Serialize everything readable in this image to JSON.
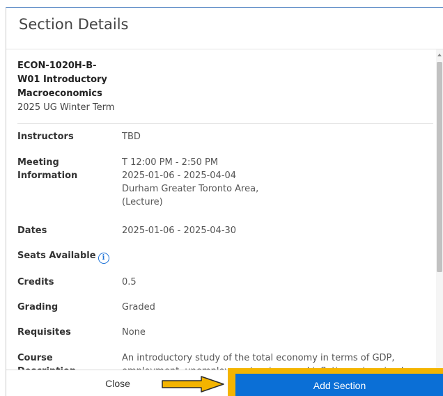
{
  "dialog": {
    "title": "Section Details"
  },
  "course": {
    "code_line1": "ECON-1020H-B-",
    "code_line2": "W01 Introductory",
    "code_line3": "Macroeconomics",
    "term": "2025 UG Winter Term"
  },
  "details": {
    "instructors_label": "Instructors",
    "instructors_value": "TBD",
    "meeting_label_line1": "Meeting",
    "meeting_label_line2": "Information",
    "meeting_time": "T 12:00 PM - 2:50 PM",
    "meeting_dates": "2025-01-06 - 2025-04-04",
    "meeting_location": "Durham Greater Toronto Area,",
    "meeting_type": "(Lecture)",
    "dates_label": "Dates",
    "dates_value": "2025-01-06 - 2025-04-30",
    "seats_label": "Seats Available",
    "seats_icon_glyph": "i",
    "credits_label": "Credits",
    "credits_value": "0.5",
    "grading_label": "Grading",
    "grading_value": "Graded",
    "requisites_label": "Requisites",
    "requisites_value": "None",
    "description_label_line1": "Course",
    "description_label_line2": "Description",
    "description_line1": "An introductory study of the total economy in terms of GDP,",
    "description_line2": "employment, unemployment, prices, and inflation using simple"
  },
  "footer": {
    "close_label": "Close",
    "add_label": "Add Section"
  },
  "colors": {
    "primary_button": "#0b6fd6",
    "highlight": "#f4b400",
    "info_icon": "#1e73d8"
  },
  "icons": {
    "info": "info-circle-icon",
    "annotation_arrow": "arrow-right-icon"
  }
}
